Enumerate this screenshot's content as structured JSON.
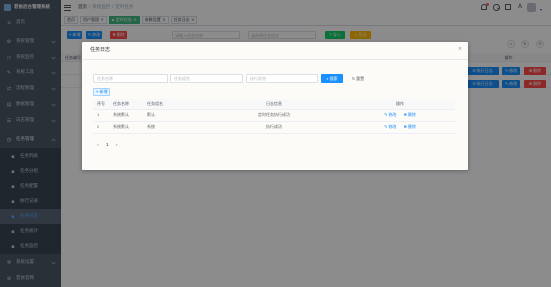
{
  "app": {
    "logo_text": "若依后台管理系统"
  },
  "theme": {
    "sidebar_bg": "#304156",
    "primary": "#1890ff",
    "success": "#13ce66",
    "warning": "#ffba00",
    "danger": "#ff4949",
    "tag_active": "#42b983"
  },
  "sidebar": {
    "items": [
      {
        "label": "首页",
        "icon": "home-icon"
      },
      {
        "label": "系统管理",
        "icon": "system-icon"
      },
      {
        "label": "系统监控",
        "icon": "monitor-icon"
      },
      {
        "label": "系统工具",
        "icon": "tool-icon"
      },
      {
        "label": "流程管理",
        "icon": "flow-icon"
      },
      {
        "label": "数据管理",
        "icon": "data-icon"
      },
      {
        "label": "日志管理",
        "icon": "log-icon"
      },
      {
        "label": "任务管理",
        "icon": "job-icon",
        "expanded": true,
        "children": [
          {
            "label": "任务列表"
          },
          {
            "label": "任务分组"
          },
          {
            "label": "任务配置"
          },
          {
            "label": "执行记录"
          },
          {
            "label": "任务日志",
            "active": true
          },
          {
            "label": "任务统计"
          },
          {
            "label": "任务监控"
          }
        ]
      },
      {
        "label": "系统设置",
        "icon": "setting-icon"
      },
      {
        "label": "若依官网",
        "icon": "link-icon"
      }
    ]
  },
  "navbar": {
    "breadcrumb": [
      "首页",
      "系统监控",
      "定时任务"
    ],
    "separator": "/",
    "icons": [
      "hamburger-icon",
      "bell-icon",
      "search-icon",
      "fullscreen-icon",
      "font-size-icon",
      "avatar",
      "caret-down-icon"
    ]
  },
  "tags": [
    {
      "label": "首页"
    },
    {
      "label": "用户管理"
    },
    {
      "label": "定时任务",
      "active": true
    },
    {
      "label": "参数设置"
    },
    {
      "label": "任务日志"
    }
  ],
  "main": {
    "toolbar": {
      "add": "新增",
      "edit": "修改",
      "delete": "删除",
      "import": "导入",
      "export": "导出"
    },
    "search": {
      "fields": [
        {
          "placeholder": "请输入任务名称"
        },
        {
          "placeholder": "请选择任务组名"
        }
      ]
    },
    "table": {
      "headers": {
        "first": "任务编号",
        "last": "操作"
      },
      "rows": [
        {
          "actions": [
            "执行日志",
            "修改",
            "删除"
          ]
        },
        {
          "actions": [
            "执行日志",
            "修改",
            "删除"
          ]
        }
      ]
    }
  },
  "dialog": {
    "title": "任务日志",
    "search": {
      "fields": [
        {
          "placeholder": "任务名称"
        },
        {
          "placeholder": "任务组名"
        },
        {
          "placeholder": "执行状态"
        }
      ],
      "search_label": "搜索",
      "reset_label": "重置"
    },
    "add_label": "新增",
    "table": {
      "headers": [
        "序号",
        "任务名称",
        "任务组名",
        "日志信息",
        "操作"
      ],
      "rows": [
        {
          "index": "1",
          "name": "系统默认",
          "group": "默认",
          "message": "定时任务执行成功",
          "actions": [
            "修改",
            "删除"
          ]
        },
        {
          "index": "2",
          "name": "系统默认",
          "group": "系统",
          "message": "执行成功",
          "actions": [
            "修改",
            "删除"
          ]
        }
      ]
    },
    "pagination": {
      "current": "1"
    }
  }
}
